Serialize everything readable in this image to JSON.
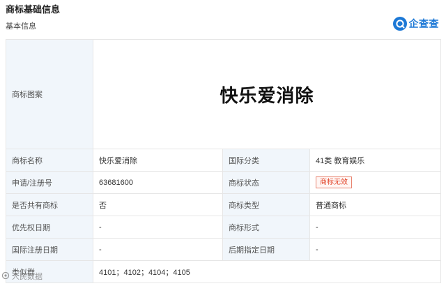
{
  "header": {
    "title": "商标基础信息",
    "subtitle": "基本信息",
    "brand": {
      "name": "企查查",
      "icon": "qcc-logo-icon",
      "color": "#1c78d6"
    }
  },
  "trademark": {
    "logo_label": "商标图案",
    "logo_text": "快乐爱消除",
    "rows": [
      {
        "k1": "商标名称",
        "v1": "快乐爱消除",
        "k2": "国际分类",
        "v2": "41类 教育娱乐"
      },
      {
        "k1": "申请/注册号",
        "v1": "63681600",
        "k2": "商标状态",
        "v2": "商标无效"
      },
      {
        "k1": "是否共有商标",
        "v1": "否",
        "k2": "商标类型",
        "v2": "普通商标"
      },
      {
        "k1": "优先权日期",
        "v1": "-",
        "k2": "商标形式",
        "v2": "-"
      },
      {
        "k1": "国际注册日期",
        "v1": "-",
        "k2": "后期指定日期",
        "v2": "-"
      }
    ],
    "similar_group_label": "类似群",
    "similar_group_value": "4101；4102；4104；4105"
  },
  "watermark": {
    "text": "人民数据",
    "icon": "camera-icon"
  },
  "colors": {
    "label_bg": "#f1f6fb",
    "border": "#e6e6e6",
    "status_red": "#e2452a"
  }
}
